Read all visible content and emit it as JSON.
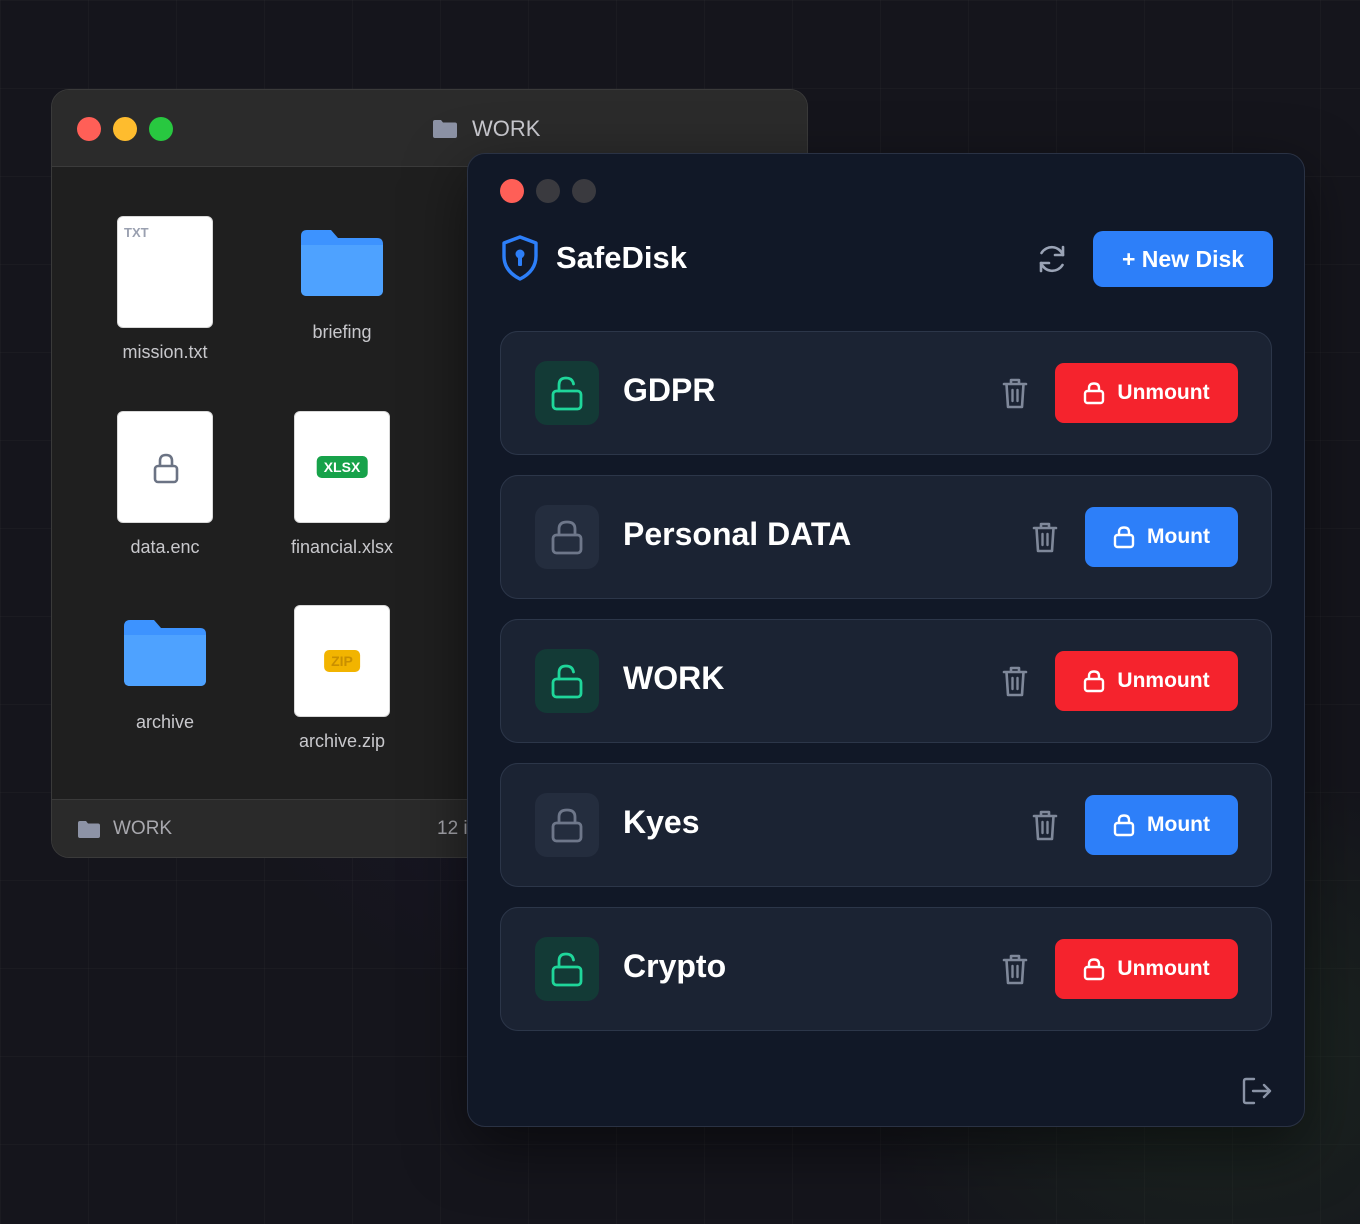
{
  "colors": {
    "accent_blue": "#2d7ff9",
    "danger_red": "#f5232d",
    "mounted_green": "#1fd69a",
    "traffic_red": "#ff5f57",
    "traffic_yellow": "#febc2e",
    "traffic_green": "#28c840"
  },
  "finder": {
    "title": "WORK",
    "files": [
      {
        "name": "mission.txt",
        "icon": "text-document-icon",
        "label": "TXT"
      },
      {
        "name": "briefing",
        "icon": "folder-icon"
      },
      {
        "name": "data.enc",
        "icon": "lock-icon"
      },
      {
        "name": "financial.xlsx",
        "icon": "spreadsheet-icon",
        "label": "XLSX"
      },
      {
        "name": "archive",
        "icon": "folder-icon"
      },
      {
        "name": "archive.zip",
        "icon": "zip-archive-icon",
        "label": "ZIP"
      }
    ],
    "status": {
      "folder": "WORK",
      "count": "12 i"
    }
  },
  "safedisk": {
    "app_title": "SafeDisk",
    "new_disk_label": "+ New Disk",
    "disks": [
      {
        "name": "GDPR",
        "state": "mounted",
        "action": "Unmount"
      },
      {
        "name": "Personal DATA",
        "state": "unmounted",
        "action": "Mount"
      },
      {
        "name": "WORK",
        "state": "mounted",
        "action": "Unmount"
      },
      {
        "name": "Kyes",
        "state": "unmounted",
        "action": "Mount"
      },
      {
        "name": "Crypto",
        "state": "mounted",
        "action": "Unmount"
      }
    ]
  }
}
